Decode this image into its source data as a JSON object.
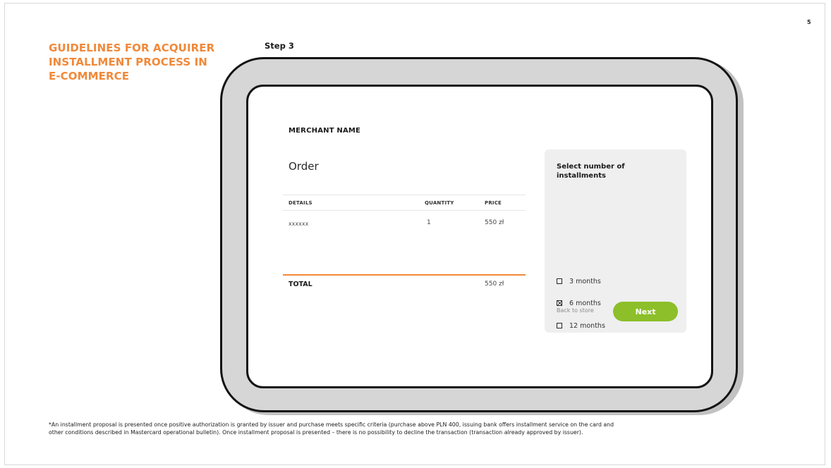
{
  "slide": {
    "page_number": "5",
    "title_lines": [
      "GUIDELINES FOR ACQUIRER",
      "INSTALLMENT PROCESS IN",
      "E-COMMERCE"
    ],
    "step_label": "Step 3",
    "footnote_lines": [
      "*An installment proposal is presented once positive authorization is granted by issuer and purchase meets specific criteria (purchase above PLN 400, issuing bank offers installment service on the card and",
      "other conditions described in Mastercard operational bulletin). Once installment proposal is presented – there is no possibility to decline the transaction (transaction already approved by issuer)."
    ]
  },
  "colors": {
    "accent_orange": "#f0893a",
    "next_button_green": "#8cbf2a",
    "panel_gray": "#efefef"
  },
  "checkout": {
    "merchant_name": "MERCHANT NAME",
    "order_heading": "Order",
    "table": {
      "headers": {
        "details": "DETAILS",
        "quantity": "QUANTITY",
        "price": "PRICE"
      },
      "rows": [
        {
          "details": "xxxxxx",
          "quantity": "1",
          "price": "550 zł"
        }
      ],
      "total_label": "TOTAL",
      "total_value": "550 zł"
    },
    "installments": {
      "title": "Select number of installments",
      "options": [
        {
          "label": "3 months",
          "checked": false
        },
        {
          "label": "6 months",
          "checked": true
        },
        {
          "label": "12 months",
          "checked": false
        }
      ],
      "back_label": "Back to store",
      "next_label": "Next"
    }
  }
}
